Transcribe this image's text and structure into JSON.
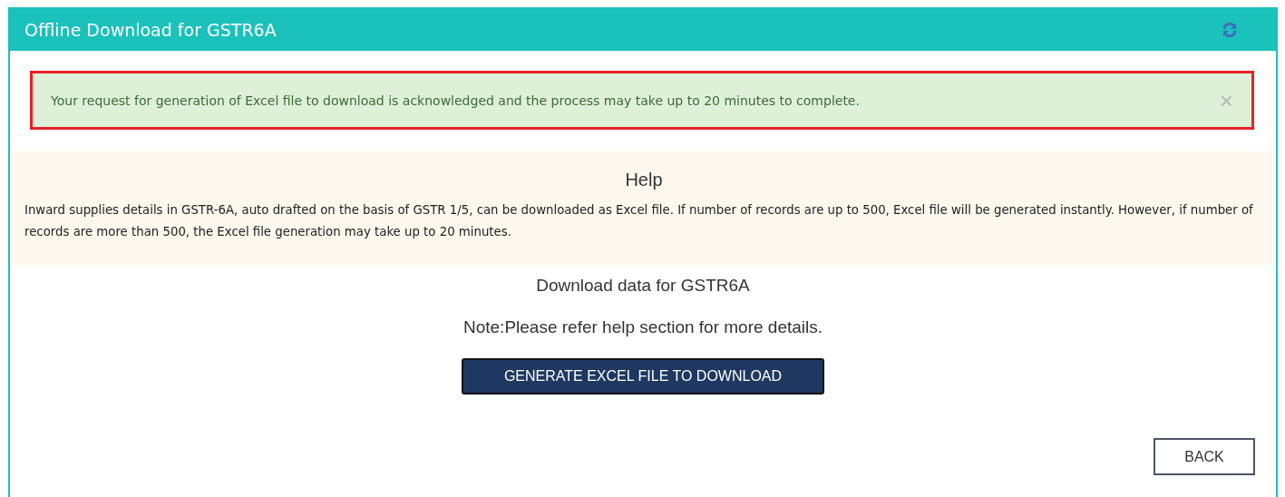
{
  "panel": {
    "title": "Offline Download for GSTR6A"
  },
  "alert": {
    "message": "Your request for generation of Excel file to download is acknowledged and the process may take up to 20 minutes to complete.",
    "close": "×",
    "highlighted": true
  },
  "help": {
    "heading": "Help",
    "text": "Inward supplies details in GSTR-6A, auto drafted on the basis of GSTR 1/5, can be downloaded as Excel file. If number of records are up to 500, Excel file will be generated instantly. However, if number of records are more than 500, the Excel file generation may take up to 20 minutes."
  },
  "download": {
    "heading": "Download data for GSTR6A",
    "note": "Note:Please refer help section for more details.",
    "button": "GENERATE EXCEL FILE TO DOWNLOAD"
  },
  "buttons": [
    "BACK"
  ]
}
